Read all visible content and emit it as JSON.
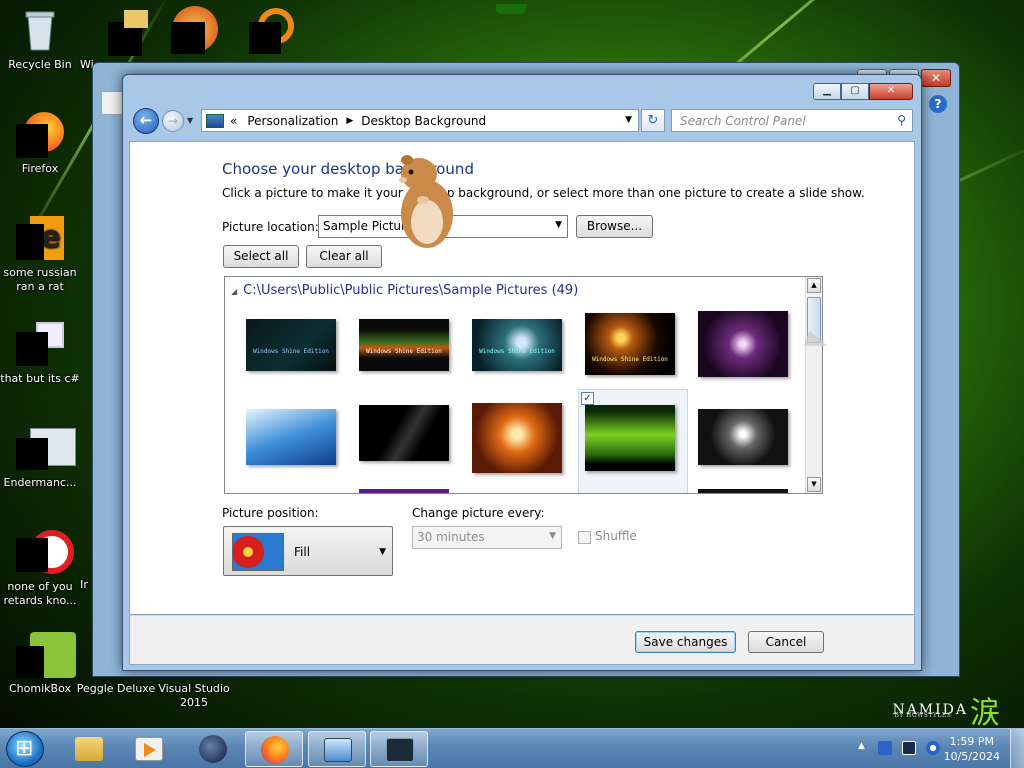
{
  "desktop": {
    "icons": [
      {
        "label": "Recycle Bin"
      },
      {
        "label": "Wi"
      },
      {
        "label": "Firefox"
      },
      {
        "label": "some russian ran a rat"
      },
      {
        "label": "that but its c#"
      },
      {
        "label": "Endermanc..."
      },
      {
        "label": "none of you retards kno..."
      },
      {
        "label": "Ir"
      },
      {
        "label": "ChomikBox"
      },
      {
        "label": "Peggle Deluxe"
      },
      {
        "label": "Visual Studio 2015"
      }
    ],
    "watermark": {
      "brand": "NAMIDA",
      "kanji": "涙",
      "byline": "BY HGWSTYLES"
    }
  },
  "window": {
    "address": {
      "prefix": "«",
      "crumbs": [
        "Personalization",
        "Desktop Background"
      ]
    },
    "search_placeholder": "Search Control Panel",
    "heading": "Choose your desktop background",
    "subtitle": "Click a picture to make it your desktop background, or select more than one picture to create a slide show.",
    "picture_location": {
      "label": "Picture location:",
      "value": "Sample Pictures"
    },
    "browse_label": "Browse...",
    "select_all_label": "Select all",
    "clear_all_label": "Clear all",
    "gallery": {
      "group_path": "C:\\Users\\Public\\Public Pictures\\Sample Pictures (49)",
      "thumbnail_captions": [
        "Windows Shine Edition",
        "Windows Shine Edition",
        "Windows Shine Edition",
        "Windows Shine Edition"
      ],
      "selected_index": 8
    },
    "picture_position": {
      "label": "Picture position:",
      "value": "Fill"
    },
    "change_every": {
      "label": "Change picture every:",
      "value": "30 minutes"
    },
    "shuffle_label": "Shuffle",
    "save_label": "Save changes",
    "cancel_label": "Cancel"
  },
  "taskbar": {
    "clock": {
      "time": "1:59 PM",
      "date": "10/5/2024"
    }
  },
  "colors": {
    "heading": "#1e3287",
    "taskbar": "#5b86b4",
    "accent_green": "#8ce22a"
  }
}
